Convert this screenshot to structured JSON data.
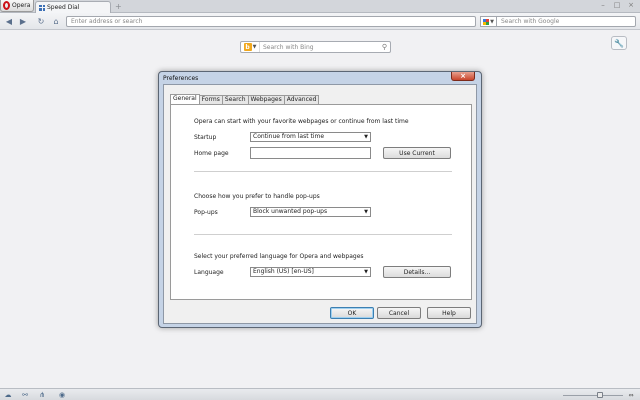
{
  "browser": {
    "menu_label": "Opera",
    "tab_title": "Speed Dial",
    "new_tab_label": "+",
    "address_placeholder": "Enter address or search",
    "search_placeholder": "Search with Google",
    "window_controls": [
      "–",
      "□",
      "×"
    ]
  },
  "speed_dial": {
    "search_placeholder": "Search with Bing",
    "engine_letter": "b",
    "config_icon": "wrench-icon"
  },
  "dialog": {
    "title": "Preferences",
    "close_label": "×",
    "tabs": [
      "General",
      "Forms",
      "Search",
      "Webpages",
      "Advanced"
    ],
    "active_tab": "General",
    "startup_section": {
      "intro": "Opera can start with your favorite webpages or continue from last time",
      "startup_label": "Startup",
      "startup_value": "Continue from last time",
      "homepage_label": "Home page",
      "homepage_value": "",
      "use_current_label": "Use Current"
    },
    "popup_section": {
      "intro": "Choose how you prefer to handle pop-ups",
      "popups_label": "Pop-ups",
      "popups_value": "Block unwanted pop-ups"
    },
    "language_section": {
      "intro": "Select your preferred language for Opera and webpages",
      "language_label": "Language",
      "language_value": "English (US) [en-US]",
      "details_label": "Details..."
    },
    "buttons": {
      "ok": "OK",
      "cancel": "Cancel",
      "help": "Help"
    }
  },
  "colors": {
    "accent": "#cc0f16",
    "dialog_frame": "#c5d3e6"
  }
}
